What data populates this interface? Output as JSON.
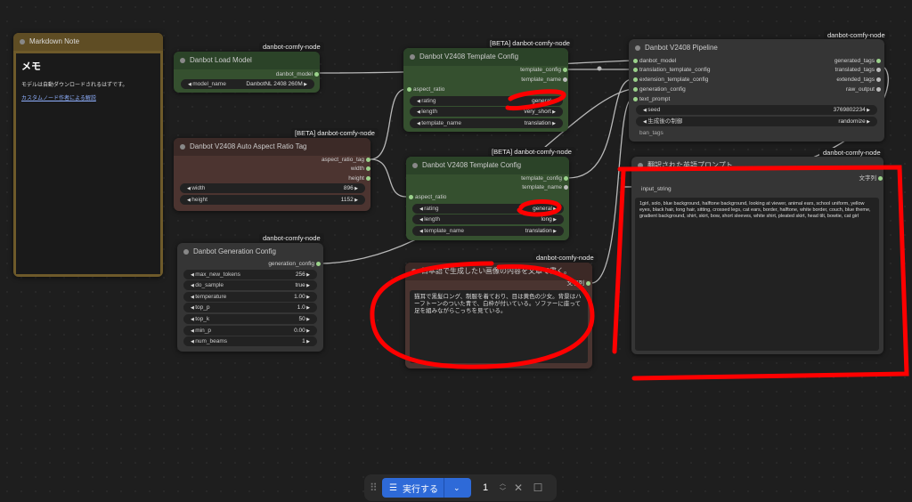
{
  "badges": {
    "b1": "danbot-comfy-node",
    "b2": "[BETA] danbot-comfy-node",
    "b3": "danbot-comfy-node",
    "b4": "[BETA] danbot-comfy-node",
    "b5": "[BETA] danbot-comfy-node",
    "b6": "danbot-comfy-node",
    "b7": "danbot-comfy-node",
    "b8": "danbot-comfy-node"
  },
  "markdown_note": {
    "title": "Markdown Note",
    "heading": "メモ",
    "text": "モデルは自動ダウンロードされるはずです。",
    "link": "カスタムノード作者による解説"
  },
  "load_model": {
    "title": "Danbot Load Model",
    "out": "danbot_model",
    "w_label": "model_name",
    "w_value": "DanbotNL 2408 260M"
  },
  "aspect": {
    "title": "Danbot V2408 Auto Aspect Ratio Tag",
    "outs": [
      "aspect_ratio_tag",
      "width",
      "height"
    ],
    "w": [
      {
        "label": "width",
        "value": "896"
      },
      {
        "label": "height",
        "value": "1152"
      }
    ]
  },
  "gen_config": {
    "title": "Danbot Generation Config",
    "out": "generation_config",
    "w": [
      {
        "label": "max_new_tokens",
        "value": "256"
      },
      {
        "label": "do_sample",
        "value": "true"
      },
      {
        "label": "temperature",
        "value": "1.00"
      },
      {
        "label": "top_p",
        "value": "1.0"
      },
      {
        "label": "top_k",
        "value": "50"
      },
      {
        "label": "min_p",
        "value": "0.00"
      },
      {
        "label": "num_beams",
        "value": "1"
      }
    ]
  },
  "template1": {
    "title": "Danbot V2408 Template Config",
    "in": "aspect_ratio",
    "outs": [
      "template_config",
      "template_name"
    ],
    "w": [
      {
        "label": "rating",
        "value": "general"
      },
      {
        "label": "length",
        "value": "very_short"
      },
      {
        "label": "template_name",
        "value": "translation"
      }
    ]
  },
  "template2": {
    "title": "Danbot V2408 Template Config",
    "in": "aspect_ratio",
    "outs": [
      "template_config",
      "template_name"
    ],
    "w": [
      {
        "label": "rating",
        "value": "general"
      },
      {
        "label": "length",
        "value": "long"
      },
      {
        "label": "template_name",
        "value": "translation"
      }
    ]
  },
  "jp_prompt": {
    "title": "日本語で生成したい画像の内容を文章で書く。",
    "out": "文字列",
    "text": "猫耳で黒髪ロング、制服を着ており、目は黄色の少女。背景はハーフトーンのついた青で、白枠が付いている。ソファーに座って足を組みながらこっちを見ている。"
  },
  "pipeline": {
    "title": "Danbot V2408 Pipeline",
    "ins": [
      "danbot_model",
      "translation_template_config",
      "extension_template_config",
      "generation_config",
      "text_prompt"
    ],
    "outs": [
      "generated_tags",
      "translated_tags",
      "extended_tags",
      "raw_output"
    ],
    "w": [
      {
        "label": "seed",
        "value": "3769802234"
      },
      {
        "label": "生成後の制御",
        "value": "randomize"
      }
    ],
    "extra_in": "ban_tags"
  },
  "translated": {
    "title": "翻訳された英語プロンプト",
    "in": "input_string",
    "out": "文字列",
    "text": "1girl, solo, blue background, halftone background, looking at viewer, animal ears, school uniform, yellow eyes, black hair, long hair, sitting, crossed legs, cat ears, border, halftone, white border, couch, blue theme, gradient background, shirt, skirt, bow, short sleeves, white shirt, pleated skirt, head tilt, bowtie, cat girl"
  },
  "toolbar": {
    "run_label": "実行する",
    "count": "1",
    "run_icon": "queue-icon",
    "accent": "#2e6ad8"
  },
  "colors": {
    "annotation": "#ff0000",
    "slot": "#9bd28b"
  }
}
